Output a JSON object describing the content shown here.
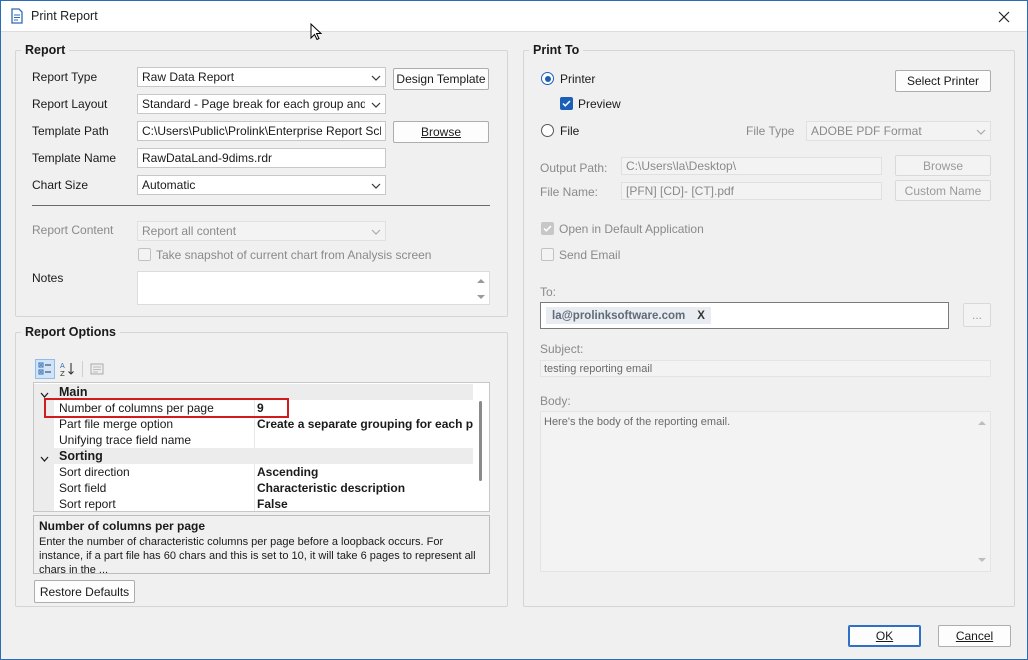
{
  "window": {
    "title": "Print Report",
    "close_symbol": "✕"
  },
  "report": {
    "group_title": "Report",
    "report_type_label": "Report Type",
    "report_type_value": "Raw Data Report",
    "design_template_label": "Design Template",
    "report_layout_label": "Report Layout",
    "report_layout_value": "Standard - Page break for each group and cycling",
    "template_path_label": "Template Path",
    "template_path_value": "C:\\Users\\Public\\Prolink\\Enterprise Report Scheduler",
    "browse_label": "Browse",
    "template_name_label": "Template Name",
    "template_name_value": "RawDataLand-9dims.rdr",
    "chart_size_label": "Chart Size",
    "chart_size_value": "Automatic",
    "report_content_label": "Report Content",
    "report_content_value": "Report all content",
    "snapshot_label": "Take snapshot of current chart from Analysis screen",
    "notes_label": "Notes"
  },
  "report_options": {
    "group_title": "Report Options",
    "categories": [
      {
        "name": "Main",
        "rows": [
          {
            "name": "Number of columns per page",
            "value": "9"
          },
          {
            "name": "Part file merge option",
            "value": "Create a separate grouping for each part"
          },
          {
            "name": "Unifying trace field name",
            "value": ""
          }
        ]
      },
      {
        "name": "Sorting",
        "rows": [
          {
            "name": "Sort direction",
            "value": "Ascending"
          },
          {
            "name": "Sort field",
            "value": "Characteristic description"
          },
          {
            "name": "Sort report",
            "value": "False"
          }
        ]
      }
    ],
    "description_title": "Number of columns per page",
    "description_text": "Enter the number of characteristic columns per page before a loopback occurs. For instance, if a part file has 60 chars and this is set to 10, it will take 6 pages to represent all chars in the ...",
    "restore_defaults_label": "Restore Defaults"
  },
  "print_to": {
    "group_title": "Print To",
    "printer_label": "Printer",
    "select_printer_label": "Select Printer",
    "preview_label": "Preview",
    "file_label": "File",
    "file_type_label": "File Type",
    "file_type_value": "ADOBE PDF Format",
    "output_path_label": "Output Path:",
    "output_path_value": "C:\\Users\\la\\Desktop\\",
    "browse_label": "Browse",
    "file_name_label": "File Name:",
    "file_name_value": "[PFN]  [CD]- [CT].pdf",
    "custom_name_label": "Custom Name",
    "open_default_label": "Open in Default Application",
    "send_email_label": "Send Email",
    "to_label": "To:",
    "to_email": "la@prolinksoftware.com",
    "chip_remove": "X",
    "more_label": "...",
    "subject_label": "Subject:",
    "subject_value": "testing reporting email",
    "body_label": "Body:",
    "body_value": "Here's the body of the reporting email."
  },
  "footer": {
    "ok_label": "OK",
    "cancel_label": "Cancel"
  }
}
